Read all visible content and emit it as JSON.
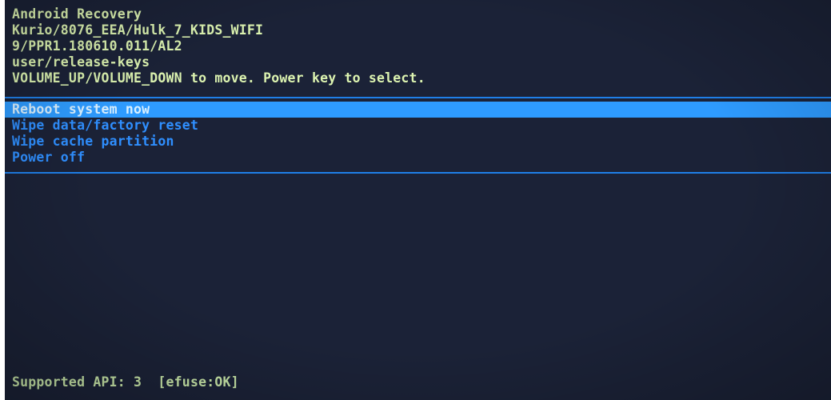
{
  "header": {
    "title": "Android Recovery",
    "build": "Kurio/8076_EEA/Hulk_7_KIDS_WIFI",
    "version": "9/PPR1.180610.011/AL2",
    "keys": "user/release-keys",
    "instructions": "VOLUME_UP/VOLUME_DOWN to move. Power key to select."
  },
  "menu": {
    "items": [
      {
        "label": "Reboot system now",
        "selected": true
      },
      {
        "label": "Wipe data/factory reset",
        "selected": false
      },
      {
        "label": "Wipe cache partition",
        "selected": false
      },
      {
        "label": "Power off",
        "selected": false
      }
    ]
  },
  "footer": {
    "status": "Supported API: 3  [efuse:OK]"
  },
  "colors": {
    "background": "#1b2237",
    "header_text": "#dcf3b0",
    "menu_text": "#2f8fff",
    "selection": "#2e9bff",
    "divider": "#1f7fe8"
  }
}
